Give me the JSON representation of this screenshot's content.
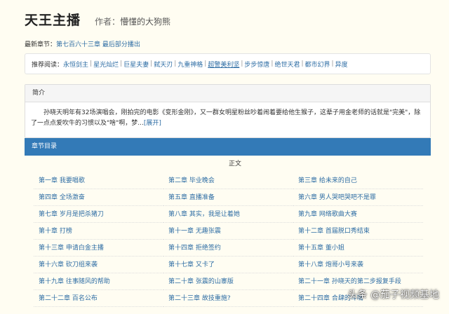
{
  "book": {
    "title": "天王主播",
    "author_label": "作者：",
    "author": "懵懂的大狗熊"
  },
  "latest": {
    "label": "最新章节：",
    "link": "第七百六十三章 最后部分播出"
  },
  "recommend": {
    "label": "推荐阅读：",
    "items": [
      "永恒剑主",
      "星光灿烂",
      "巨星夫妻",
      "弑天刃",
      "九重神格",
      "超警美利坚",
      "步步惊唐",
      "绝世天君",
      "都市幻界",
      "异度"
    ]
  },
  "intro": {
    "header": "简介",
    "text": "孙晓天明年有32场演唱会，刚拍完的电影《变形金刚》，又一群女明星粉丝吵着闹着要给他生猴子，这辈子用金老师的话就是\"完美\"，除了一点点爱吹牛的习惯以及\"啥\"啊，梦...",
    "expand": "[展开]"
  },
  "toc": {
    "header": "章节目录",
    "volume": "正文",
    "chapters": [
      "第一章 我要唱歌",
      "第二章 毕业晚会",
      "第三章 给未来的自己",
      "第四章 全场激奋",
      "第五章 直播准备",
      "第六章 男人哭吧哭吧不是罪",
      "第七章 岁月是把杀猪刀",
      "第八章 其实，我是让着她",
      "第九章 网络歌曲大赛",
      "第十章 打榜",
      "第十一章 无趣张震",
      "第十二章 首届脱口秀结束",
      "第十三章 申请白金主播",
      "第十四章 拒绝签约",
      "第十五章 董小姐",
      "第十六章 砍刀组来袭",
      "第十七章 又卡了",
      "第十八章 炮哥小号来袭",
      "第十九章 往事随风的帮助",
      "第二十章 张震的山寨版",
      "第二十一章 孙晓天的第二步报复手段",
      "第二十二章 百名公布",
      "第二十三章 故技重施?",
      "第二十四章 合肆的斗嘴"
    ]
  },
  "watermark": "头条 @茄子视频基地"
}
